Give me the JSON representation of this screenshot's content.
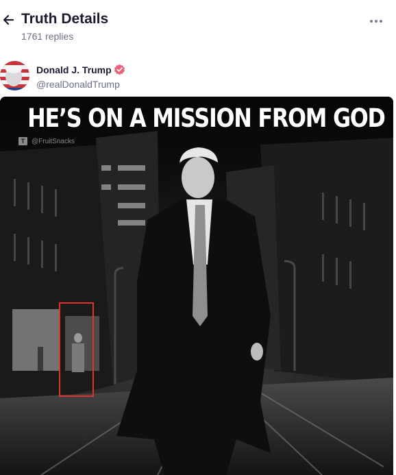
{
  "header": {
    "title": "Truth Details",
    "replies": "1761 replies"
  },
  "author": {
    "display_name": "Donald J. Trump",
    "handle": "@realDonaldTrump",
    "verified": true
  },
  "post": {
    "image": {
      "caption": "HE’S ON A MISSION FROM GOD",
      "watermark": "@FruitSnacks"
    }
  },
  "icons": {
    "back": "arrow-left-icon",
    "more": "more-horizontal-icon",
    "verified": "verified-badge-icon"
  },
  "colors": {
    "text_primary": "#1b1b2f",
    "text_secondary": "#6b6f86",
    "verified_badge": "#e8637a",
    "highlight_box": "#e0322a"
  }
}
